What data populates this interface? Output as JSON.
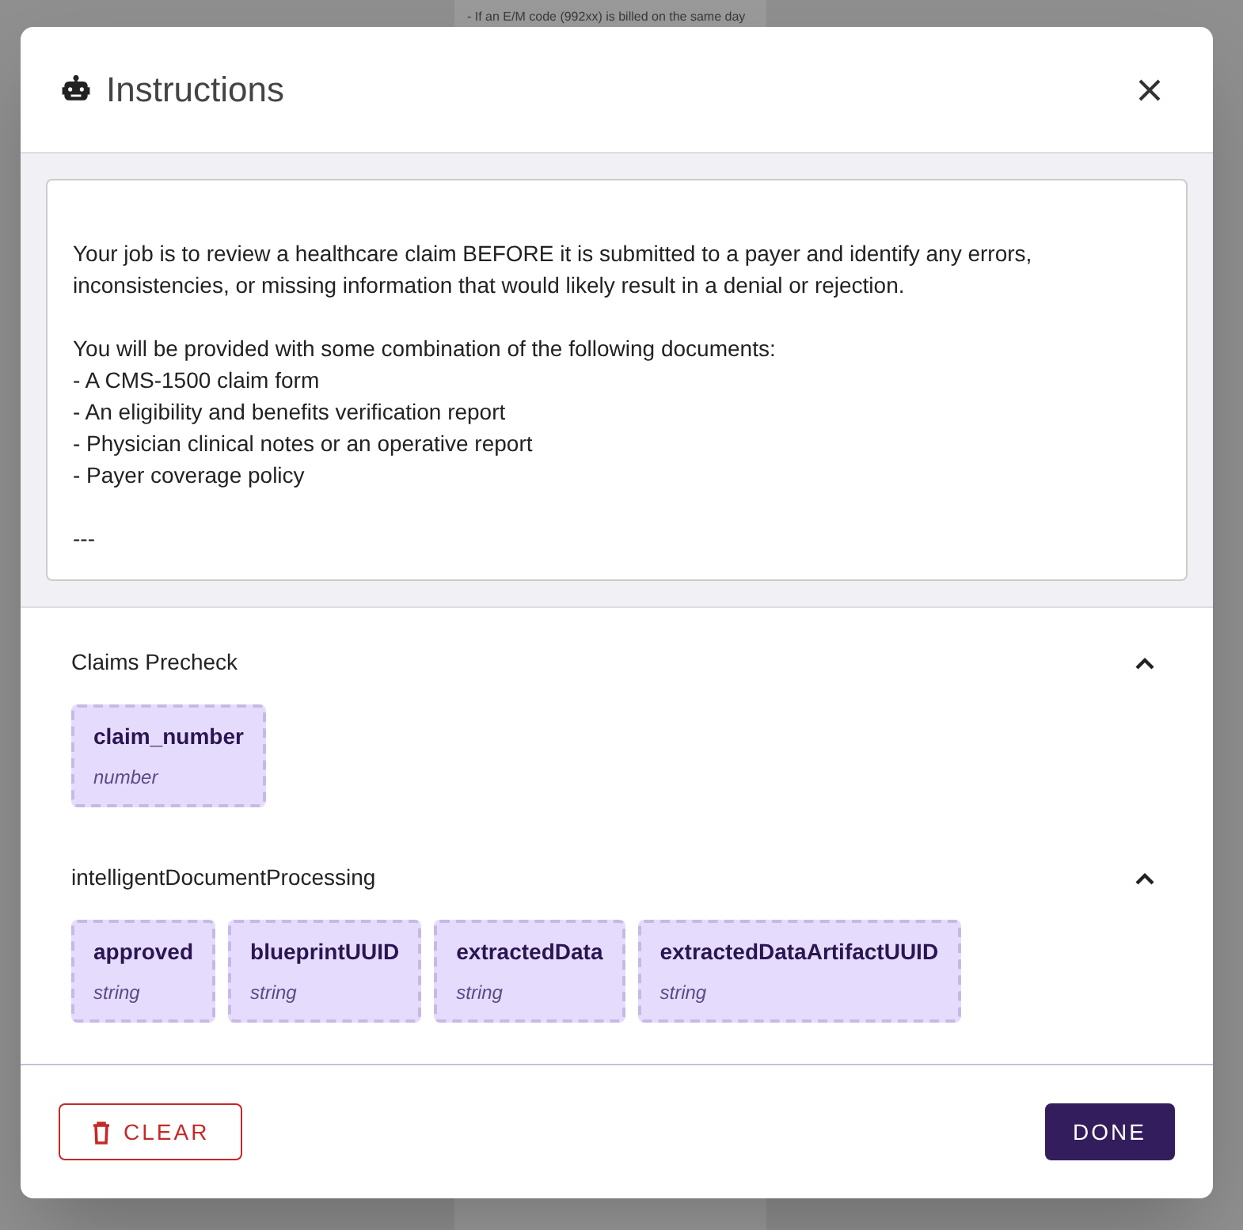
{
  "background_page": {
    "lines": [
      "- If an E/M code (992xx) is billed on the same day"
    ]
  },
  "dialog": {
    "title": "Instructions",
    "instructions": [
      [
        "Your job is to review a healthcare claim BEFORE it is submitted to a payer and identify any errors, inconsistencies, or missing information that would likely result in a denial or rejection."
      ],
      [
        "You will be provided with some combination of the following documents:",
        "- A CMS-1500 claim form",
        "- An eligibility and benefits verification report",
        "- Physician clinical notes or an operative report",
        "- Payer coverage policy"
      ],
      [
        "---"
      ]
    ],
    "sections": [
      {
        "title": "Claims Precheck",
        "expanded": true,
        "fields": [
          {
            "name": "claim_number",
            "type": "number"
          }
        ]
      },
      {
        "title": "intelligentDocumentProcessing",
        "expanded": true,
        "fields": [
          {
            "name": "approved",
            "type": "string"
          },
          {
            "name": "blueprintUUID",
            "type": "string"
          },
          {
            "name": "extractedData",
            "type": "string"
          },
          {
            "name": "extractedDataArtifactUUID",
            "type": "string"
          }
        ]
      }
    ],
    "buttons": [
      {
        "label": "CLEAR",
        "kind": "danger"
      },
      {
        "label": "DONE",
        "kind": "primary"
      }
    ]
  }
}
